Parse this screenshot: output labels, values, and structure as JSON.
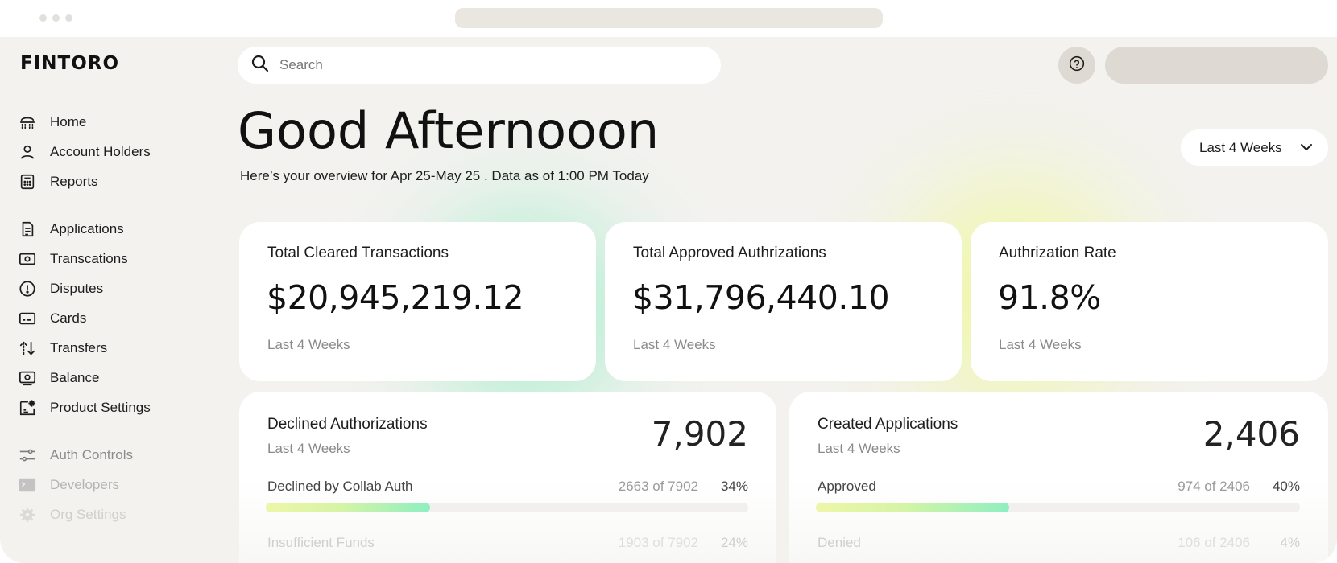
{
  "app": {
    "logo": "FINTORO"
  },
  "nav": {
    "items": [
      {
        "label": "Home",
        "icon": "home-icon"
      },
      {
        "label": "Account Holders",
        "icon": "user-icon"
      },
      {
        "label": "Reports",
        "icon": "calculator-icon"
      },
      {
        "label": "Applications",
        "icon": "document-icon"
      },
      {
        "label": "Transcations",
        "icon": "banknote-icon"
      },
      {
        "label": "Disputes",
        "icon": "alert-circle-icon"
      },
      {
        "label": "Cards",
        "icon": "card-icon"
      },
      {
        "label": "Transfers",
        "icon": "transfer-arrows-icon"
      },
      {
        "label": "Balance",
        "icon": "balance-icon"
      },
      {
        "label": "Product Settings",
        "icon": "product-settings-icon"
      },
      {
        "label": "Auth Controls",
        "icon": "sliders-icon"
      },
      {
        "label": "Developers",
        "icon": "terminal-icon"
      },
      {
        "label": "Org Settings",
        "icon": "gear-icon"
      }
    ]
  },
  "search": {
    "placeholder": "Search"
  },
  "header": {
    "greeting": "Good Afternooon",
    "subtitle": "Here’s your overview for Apr 25-May 25 . Data as of 1:00 PM Today",
    "range_label": "Last 4 Weeks"
  },
  "stats": [
    {
      "title": "Total Cleared Transactions",
      "value": "$20,945,219.12",
      "period": "Last 4 Weeks"
    },
    {
      "title": "Total Approved Authrizations",
      "value": "$31,796,440.10",
      "period": "Last 4 Weeks"
    },
    {
      "title": "Authrization Rate",
      "value": "91.8%",
      "period": "Last 4 Weeks"
    }
  ],
  "declined": {
    "title": "Declined Authorizations",
    "period": "Last 4 Weeks",
    "total": "7,902",
    "rows": [
      {
        "label": "Declined by Collab Auth",
        "count": "2663 of 7902",
        "pct": "34%",
        "fraction": 0.34
      },
      {
        "label": "Insufficient Funds",
        "count": "1903 of 7902",
        "pct": "24%",
        "fraction": 0.24
      }
    ]
  },
  "created": {
    "title": "Created Applications",
    "period": "Last 4 Weeks",
    "total": "2,406",
    "rows": [
      {
        "label": "Approved",
        "count": "974 of 2406",
        "pct": "40%",
        "fraction": 0.4
      },
      {
        "label": "Denied",
        "count": "106 of 2406",
        "pct": "4%",
        "fraction": 0.04
      }
    ]
  },
  "colors": {
    "background": "#f3f2ef",
    "accent_green": "#8eefc0",
    "accent_yellow": "#eef6a8"
  }
}
